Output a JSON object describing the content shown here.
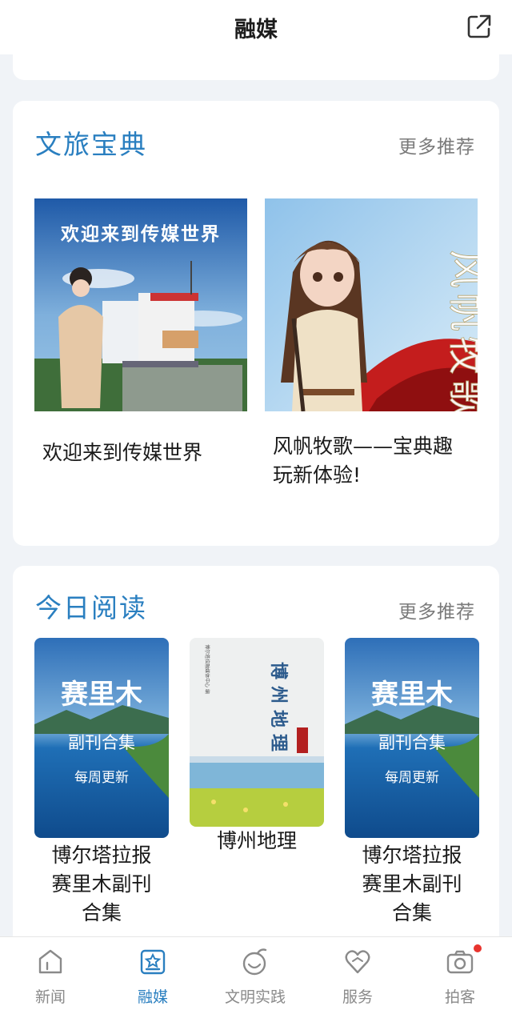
{
  "header": {
    "title": "融媒"
  },
  "section_culture": {
    "title": "文旅宝典",
    "more": "更多推荐",
    "items": [
      {
        "label": "欢迎来到传媒世界",
        "cover_text": "欢迎来到传媒世界"
      },
      {
        "label": "风帆牧歌——宝典趣玩新体验!",
        "cover_text": "风帆牧歌"
      }
    ]
  },
  "section_reading": {
    "title": "今日阅读",
    "more": "更多推荐",
    "books": [
      {
        "label": "博尔塔拉报赛里木副刊合集",
        "cover_title": "赛里木",
        "cover_subtitle": "副刊合集",
        "cover_note": "每周更新"
      },
      {
        "label": "博州地理",
        "cover_title": "博州地理",
        "cover_side": "博尔塔拉融媒体中心 编"
      },
      {
        "label": "博尔塔拉报赛里木副刊合集",
        "cover_title": "赛里木",
        "cover_subtitle": "副刊合集",
        "cover_note": "每周更新"
      }
    ]
  },
  "tabbar": {
    "tabs": [
      {
        "label": "新闻",
        "icon": "home-icon"
      },
      {
        "label": "融媒",
        "icon": "star-tablet-icon",
        "active": true
      },
      {
        "label": "文明实践",
        "icon": "lantern-icon"
      },
      {
        "label": "服务",
        "icon": "heart-icon"
      },
      {
        "label": "拍客",
        "icon": "camera-icon"
      }
    ]
  },
  "colors": {
    "accent": "#2a7fc0",
    "badge": "#e8342e",
    "background": "#f0f3f7",
    "text": "#1a1a1a",
    "muted": "#7a7a7a"
  }
}
